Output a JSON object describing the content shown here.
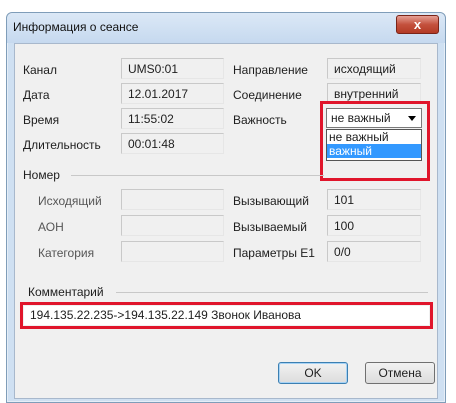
{
  "window": {
    "title": "Информация о сеансе",
    "close_label": "x"
  },
  "session": {
    "channel_label": "Канал",
    "channel_value": "UMS0:01",
    "date_label": "Дата",
    "date_value": "12.01.2017",
    "time_label": "Время",
    "time_value": "11:55:02",
    "duration_label": "Длительность",
    "duration_value": "00:01:48",
    "direction_label": "Направление",
    "direction_value": "исходящий",
    "connection_label": "Соединение",
    "connection_value": "внутренний",
    "importance_label": "Важность",
    "importance": {
      "selected": "не важный",
      "options": [
        "не важный",
        "важный"
      ],
      "highlighted": "важный"
    }
  },
  "number_group": {
    "title": "Номер",
    "outgoing_label": "Исходящий",
    "outgoing_value": "",
    "aon_label": "АОН",
    "aon_value": "",
    "category_label": "Категория",
    "category_value": "",
    "caller_label": "Вызывающий",
    "caller_value": "101",
    "callee_label": "Вызываемый",
    "callee_value": "100",
    "e1_label": "Параметры E1",
    "e1_value": "0/0"
  },
  "comment_group": {
    "title": "Комментарий",
    "value": "194.135.22.235->194.135.22.149 Звонок Иванова"
  },
  "buttons": {
    "ok": "OK",
    "cancel": "Отмена"
  },
  "colors": {
    "highlight_frame": "#e0152b",
    "selection": "#3399ff"
  }
}
